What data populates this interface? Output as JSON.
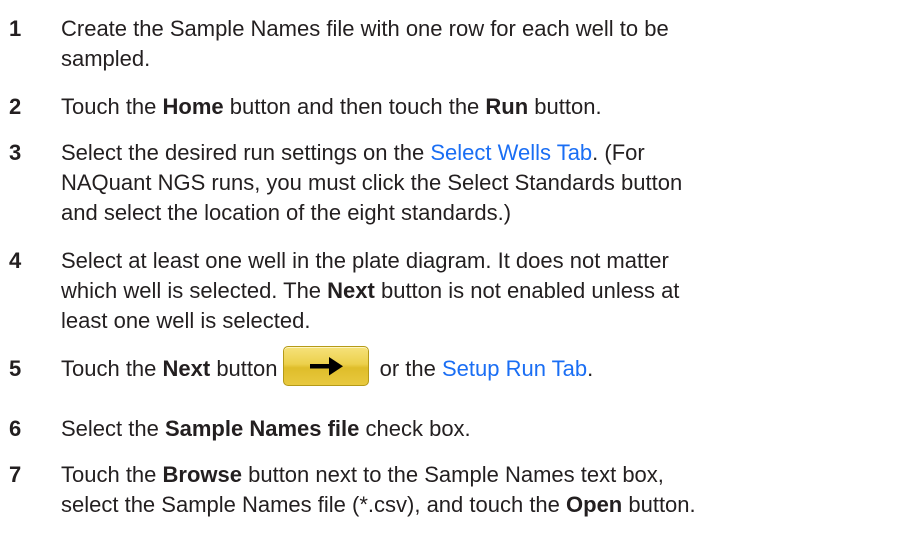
{
  "steps": [
    {
      "num": "1",
      "lines": [
        "Create the Sample Names file with one row for each well to be",
        "sampled."
      ]
    },
    {
      "num": "2",
      "l1_a": "Touch the ",
      "l1_b": "Home",
      "l1_c": " button and then touch the ",
      "l1_d": "Run",
      "l1_e": " button."
    },
    {
      "num": "3",
      "l1_a": "Select the desired run settings on the ",
      "l1_link": "Select Wells Tab",
      "l1_b": ". (For",
      "l2": "NAQuant NGS runs, you must click the Select Standards button",
      "l3": "and select the location of the eight standards.)"
    },
    {
      "num": "4",
      "l1": "Select at least one well in the plate diagram. It does not matter",
      "l2_a": "which well is selected. The ",
      "l2_b": "Next",
      "l2_c": " button is not enabled unless at",
      "l3": "least one well is selected."
    },
    {
      "num": "5",
      "l1_a": "Touch the ",
      "l1_b": "Next",
      "l1_c": " button",
      "l1_d": " or the ",
      "l1_link": "Setup Run Tab",
      "l1_e": ".",
      "button_icon": "right-arrow-icon",
      "button_color": "#e8c93f"
    },
    {
      "num": "6",
      "l1_a": "Select the ",
      "l1_b": "Sample Names file",
      "l1_c": " check box."
    },
    {
      "num": "7",
      "l1_a": "Touch the ",
      "l1_b": "Browse",
      "l1_c": " button next to the Sample Names text box,",
      "l2_a": "select the Sample Names file (*.csv), and touch the ",
      "l2_b": "Open",
      "l2_c": " button."
    }
  ],
  "colors": {
    "text": "#231f20",
    "link": "#1a6ef4"
  }
}
